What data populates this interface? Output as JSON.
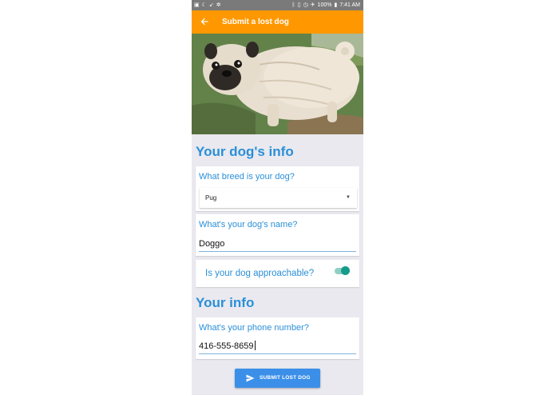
{
  "status_bar": {
    "battery": "100%",
    "time": "7:41 AM"
  },
  "app_bar": {
    "title": "Submit a lost dog",
    "back_icon": "arrow-left-icon"
  },
  "dog_info": {
    "section_title": "Your dog's info",
    "breed": {
      "label": "What breed is your dog?",
      "selected": "Pug"
    },
    "name": {
      "label": "What's your dog's name?",
      "value": "Doggo"
    },
    "approachable": {
      "label": "Is your dog approachable?",
      "on": true
    }
  },
  "your_info": {
    "section_title": "Your info",
    "phone": {
      "label": "What's your phone number?",
      "value": "416-555-8659"
    }
  },
  "submit": {
    "label": "SUBMIT LOST DOG",
    "icon": "send-icon"
  },
  "colors": {
    "accent": "#ff9800",
    "primary_text": "#2a8fd8",
    "button": "#3b8fe8",
    "toggle": "#159b8a"
  }
}
